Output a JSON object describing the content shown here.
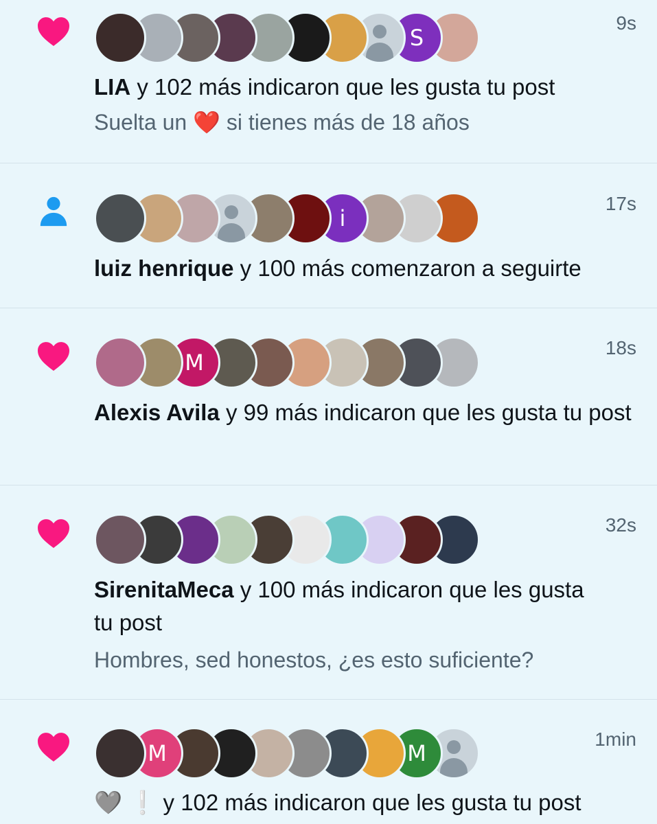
{
  "icons": {
    "like": "heart-icon",
    "follow": "person-icon"
  },
  "colors": {
    "like_icon": "#f91880",
    "follow_icon": "#1d9bf0",
    "background": "#e9f6fb",
    "muted_text": "#536471"
  },
  "notifications": [
    {
      "kind": "like",
      "time": "9s",
      "actor": "LIA",
      "rest": " y 102 más indicaron que les gusta tu post",
      "sub_before": "Suelta un ",
      "sub_emoji": "❤️",
      "sub_after": " si tienes más de 18 años",
      "avatars": [
        {
          "bg": "#3b2b2a"
        },
        {
          "bg": "#a9b0b7"
        },
        {
          "bg": "#6b6260"
        },
        {
          "bg": "#5a3a4e"
        },
        {
          "bg": "#9aa4a0"
        },
        {
          "bg": "#1a1a1a"
        },
        {
          "bg": "#d9a047"
        },
        {
          "bg": "default"
        },
        {
          "bg": "#7e2fbd",
          "letter": "S"
        },
        {
          "bg": "#d3a79a"
        }
      ]
    },
    {
      "kind": "follow",
      "time": "17s",
      "actor": "luiz henrique",
      "rest": " y 100 más comenzaron a seguirte",
      "avatars": [
        {
          "bg": "#4a4f52"
        },
        {
          "bg": "#c9a57c"
        },
        {
          "bg": "#bfa6a8"
        },
        {
          "bg": "default"
        },
        {
          "bg": "#8d7e6c"
        },
        {
          "bg": "#6e1010"
        },
        {
          "bg": "#7b2fbe",
          "letter": "i"
        },
        {
          "bg": "#b3a39a"
        },
        {
          "bg": "#cfcfcf"
        },
        {
          "bg": "#c45a1e"
        }
      ]
    },
    {
      "kind": "like",
      "time": "18s",
      "actor": "Alexis Avila",
      "rest": " y 99 más indicaron que les gusta tu post",
      "avatars": [
        {
          "bg": "#b06a8a"
        },
        {
          "bg": "#9d8c6a"
        },
        {
          "bg": "#c21866",
          "letter": "M"
        },
        {
          "bg": "#5e5a50"
        },
        {
          "bg": "#7a5a50"
        },
        {
          "bg": "#d6a080"
        },
        {
          "bg": "#c9c2b6"
        },
        {
          "bg": "#8a7866"
        },
        {
          "bg": "#4e5158"
        },
        {
          "bg": "#b5b8bc"
        }
      ]
    },
    {
      "kind": "like",
      "time": "32s",
      "actor": "SirenitaMeca",
      "rest": " y 100 más indicaron que les gusta tu post",
      "sub": "Hombres, sed honestos, ¿es esto suficiente?",
      "avatars": [
        {
          "bg": "#6d5660"
        },
        {
          "bg": "#3b3b3b"
        },
        {
          "bg": "#6b2e8a"
        },
        {
          "bg": "#b9cfb6"
        },
        {
          "bg": "#4a3e36"
        },
        {
          "bg": "#e9e9e9"
        },
        {
          "bg": "#6fc7c6"
        },
        {
          "bg": "#d8d0f2"
        },
        {
          "bg": "#5a2121"
        },
        {
          "bg": "#2d3a4e"
        }
      ]
    },
    {
      "kind": "like",
      "time": "1min",
      "actor": "🩶 ❕",
      "rest": " y 102 más indicaron que les gusta tu post",
      "avatars": [
        {
          "bg": "#3a3030"
        },
        {
          "bg": "#e0407a",
          "letter": "M"
        },
        {
          "bg": "#4a3a30"
        },
        {
          "bg": "#202020"
        },
        {
          "bg": "#c4b2a4"
        },
        {
          "bg": "#8c8c8c"
        },
        {
          "bg": "#3c4a56"
        },
        {
          "bg": "#e8a63a"
        },
        {
          "bg": "#2e8b3a",
          "letter": "M"
        },
        {
          "bg": "default"
        }
      ]
    }
  ]
}
